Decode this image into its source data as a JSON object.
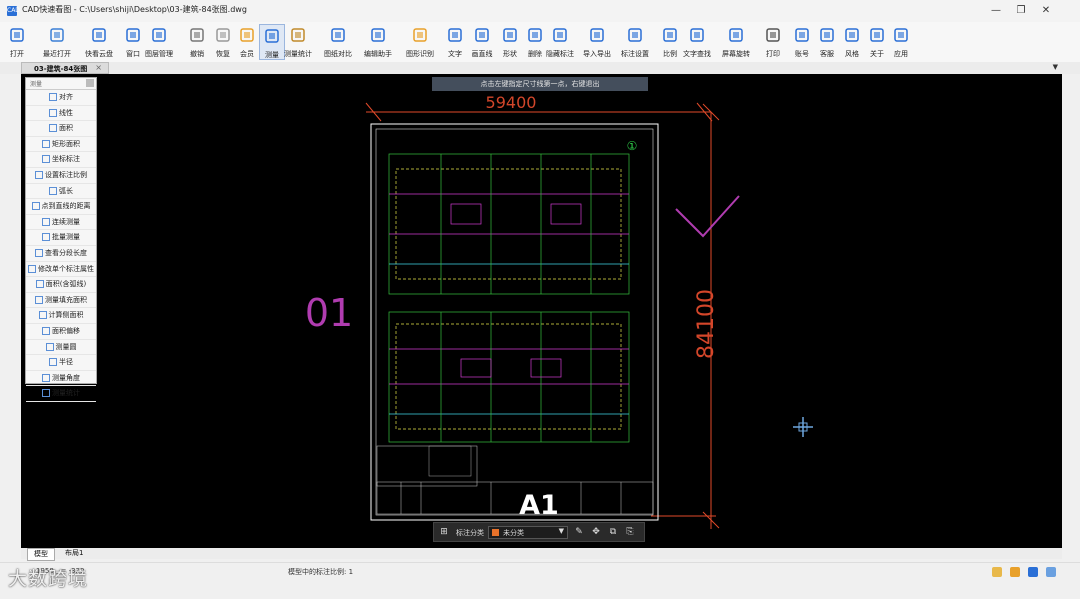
{
  "window": {
    "title": "CAD快速看图 - C:\\Users\\shiji\\Desktop\\03-建筑-84张图.dwg",
    "app_icon": "CAD",
    "controls": [
      "—",
      "❐",
      "✕"
    ]
  },
  "toolbar": {
    "items": [
      {
        "label": "打开",
        "icon": "folder-open-icon"
      },
      {
        "label": "最近打开",
        "icon": "clock-icon"
      },
      {
        "label": "快看云盘",
        "icon": "cloud-icon"
      },
      {
        "label": "窗口",
        "icon": "window-icon"
      },
      {
        "label": "图层管理",
        "icon": "layers-icon"
      },
      {
        "label": "撤销",
        "icon": "undo-icon"
      },
      {
        "label": "恢复",
        "icon": "redo-icon"
      },
      {
        "label": "会员",
        "icon": "vip-icon"
      },
      {
        "label": "测量",
        "icon": "measure-icon"
      },
      {
        "label": "测量统计",
        "icon": "measure-stats-icon"
      },
      {
        "label": "图纸对比",
        "icon": "compare-icon"
      },
      {
        "label": "编辑助手",
        "icon": "edit-assistant-icon"
      },
      {
        "label": "图形识别",
        "icon": "recognize-icon"
      },
      {
        "label": "文字",
        "icon": "text-icon"
      },
      {
        "label": "画直线",
        "icon": "line-icon"
      },
      {
        "label": "形状",
        "icon": "shape-icon"
      },
      {
        "label": "删除",
        "icon": "eraser-icon"
      },
      {
        "label": "隐藏标注",
        "icon": "hide-annotation-icon"
      },
      {
        "label": "导入导出",
        "icon": "import-export-icon"
      },
      {
        "label": "标注设置",
        "icon": "annotation-settings-icon"
      },
      {
        "label": "比例",
        "icon": "scale-icon"
      },
      {
        "label": "文字查找",
        "icon": "text-search-icon"
      },
      {
        "label": "屏幕旋转",
        "icon": "rotate-icon"
      },
      {
        "label": "打印",
        "icon": "print-icon"
      },
      {
        "label": "账号",
        "icon": "user-icon"
      },
      {
        "label": "客服",
        "icon": "headset-icon"
      },
      {
        "label": "风格",
        "icon": "style-icon"
      },
      {
        "label": "关于",
        "icon": "info-icon"
      },
      {
        "label": "应用",
        "icon": "apps-icon"
      }
    ]
  },
  "document_tab": {
    "label": "03-建筑-84张图",
    "close": "×",
    "menu": "▼"
  },
  "measure_panel": {
    "title": "测量",
    "items": [
      "对齐",
      "线性",
      "面积",
      "矩形面积",
      "坐标标注",
      "设置标注比例",
      "弧长",
      "点到直线的距离",
      "连续测量",
      "批量测量",
      "查看分段长度",
      "修改单个标注属性",
      "面积(含弧线)",
      "测量填充面积",
      "计算侧面积",
      "面积偏移",
      "测量圆",
      "半径",
      "测量角度",
      "测量统计"
    ]
  },
  "canvas": {
    "prompt": "点击左键指定尺寸线第一点，右键退出",
    "dim_width": "59400",
    "dim_height": "84100",
    "label_left": "01",
    "sheet_label": "A1",
    "sheet_number": "①"
  },
  "bottom_toolbar": {
    "label": "标注分类",
    "value": "未分类",
    "arrow": "▼",
    "icons": [
      "⊞",
      "✎",
      "✥",
      "⧉",
      "⎘"
    ]
  },
  "layout_tabs": [
    "模型",
    "布局1"
  ],
  "status": {
    "coords": "1958 , = -339",
    "scale_text": "模型中的标注比例: 1"
  },
  "watermark": "大数跨境",
  "colors": {
    "canvas": "#000000",
    "accent": "#2a6fd6",
    "drawing_frame": "#ffffff"
  }
}
